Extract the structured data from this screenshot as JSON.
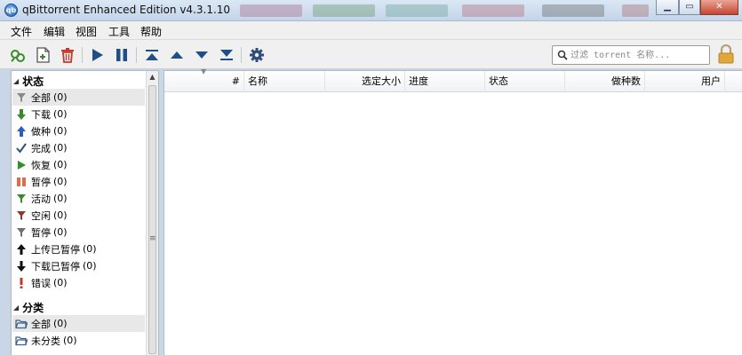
{
  "window": {
    "title": "qBittorrent Enhanced Edition v4.3.1.10"
  },
  "menu": [
    "文件",
    "编辑",
    "视图",
    "工具",
    "帮助"
  ],
  "toolbar": {
    "buttons": [
      "add-torrent-icon",
      "add-file-icon",
      "delete-icon",
      "resume-icon",
      "pause-icon",
      "top-priority-icon",
      "increase-priority-icon",
      "decrease-priority-icon",
      "bottom-priority-icon",
      "options-gear-icon"
    ],
    "search_placeholder": "过滤 torrent 名称..."
  },
  "sidebar": {
    "status_header": "状态",
    "status_items": [
      {
        "label": "全部",
        "count": "(0)",
        "icon": "filter-icon",
        "selected": true
      },
      {
        "label": "下载",
        "count": "(0)",
        "icon": "arrow-down-icon"
      },
      {
        "label": "做种",
        "count": "(0)",
        "icon": "arrow-up-icon"
      },
      {
        "label": "完成",
        "count": "(0)",
        "icon": "checkmark-icon"
      },
      {
        "label": "恢复",
        "count": "(0)",
        "icon": "play-icon"
      },
      {
        "label": "暂停",
        "count": "(0)",
        "icon": "pause-icon"
      },
      {
        "label": "活动",
        "count": "(0)",
        "icon": "filter-green-icon"
      },
      {
        "label": "空闲",
        "count": "(0)",
        "icon": "filter-red-icon"
      },
      {
        "label": "暂停",
        "count": "(0)",
        "icon": "filter-gray-icon"
      },
      {
        "label": "上传已暂停",
        "count": "(0)",
        "icon": "arrow-up-black-icon"
      },
      {
        "label": "下载已暂停",
        "count": "(0)",
        "icon": "arrow-down-black-icon"
      },
      {
        "label": "错误",
        "count": "(0)",
        "icon": "exclamation-icon"
      }
    ],
    "category_header": "分类",
    "category_items": [
      {
        "label": "全部",
        "count": "(0)",
        "icon": "folder-icon",
        "selected": true
      },
      {
        "label": "未分类",
        "count": "(0)",
        "icon": "folder-icon"
      }
    ]
  },
  "table": {
    "columns": [
      "#",
      "名称",
      "选定大小",
      "进度",
      "状态",
      "做种数",
      "用户"
    ],
    "rows": []
  },
  "colors": {
    "green_arrow": "#3b8a2a",
    "blue_arrow": "#2c5fb5",
    "red_delete": "#c0392b",
    "play_blue": "#1f4f86",
    "pause_orange": "#e36b4c"
  }
}
